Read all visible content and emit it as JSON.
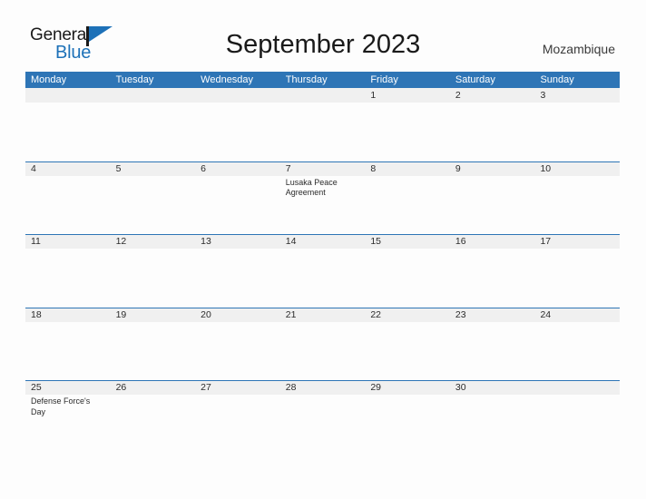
{
  "header": {
    "logo": {
      "word1": "General",
      "word2": "Blue",
      "flag_icon": "flag-triangle-icon",
      "brand_color": "#1D71B8"
    },
    "title": "September 2023",
    "country": "Mozambique"
  },
  "calendar": {
    "accent_color": "#2E75B6",
    "band_color": "#F0F0F0",
    "weekdays": [
      "Monday",
      "Tuesday",
      "Wednesday",
      "Thursday",
      "Friday",
      "Saturday",
      "Sunday"
    ],
    "weeks": [
      [
        {
          "date": "",
          "event": ""
        },
        {
          "date": "",
          "event": ""
        },
        {
          "date": "",
          "event": ""
        },
        {
          "date": "",
          "event": ""
        },
        {
          "date": "1",
          "event": ""
        },
        {
          "date": "2",
          "event": ""
        },
        {
          "date": "3",
          "event": ""
        }
      ],
      [
        {
          "date": "4",
          "event": ""
        },
        {
          "date": "5",
          "event": ""
        },
        {
          "date": "6",
          "event": ""
        },
        {
          "date": "7",
          "event": "Lusaka Peace Agreement"
        },
        {
          "date": "8",
          "event": ""
        },
        {
          "date": "9",
          "event": ""
        },
        {
          "date": "10",
          "event": ""
        }
      ],
      [
        {
          "date": "11",
          "event": ""
        },
        {
          "date": "12",
          "event": ""
        },
        {
          "date": "13",
          "event": ""
        },
        {
          "date": "14",
          "event": ""
        },
        {
          "date": "15",
          "event": ""
        },
        {
          "date": "16",
          "event": ""
        },
        {
          "date": "17",
          "event": ""
        }
      ],
      [
        {
          "date": "18",
          "event": ""
        },
        {
          "date": "19",
          "event": ""
        },
        {
          "date": "20",
          "event": ""
        },
        {
          "date": "21",
          "event": ""
        },
        {
          "date": "22",
          "event": ""
        },
        {
          "date": "23",
          "event": ""
        },
        {
          "date": "24",
          "event": ""
        }
      ],
      [
        {
          "date": "25",
          "event": "Defense Force's Day"
        },
        {
          "date": "26",
          "event": ""
        },
        {
          "date": "27",
          "event": ""
        },
        {
          "date": "28",
          "event": ""
        },
        {
          "date": "29",
          "event": ""
        },
        {
          "date": "30",
          "event": ""
        },
        {
          "date": "",
          "event": ""
        }
      ]
    ]
  }
}
